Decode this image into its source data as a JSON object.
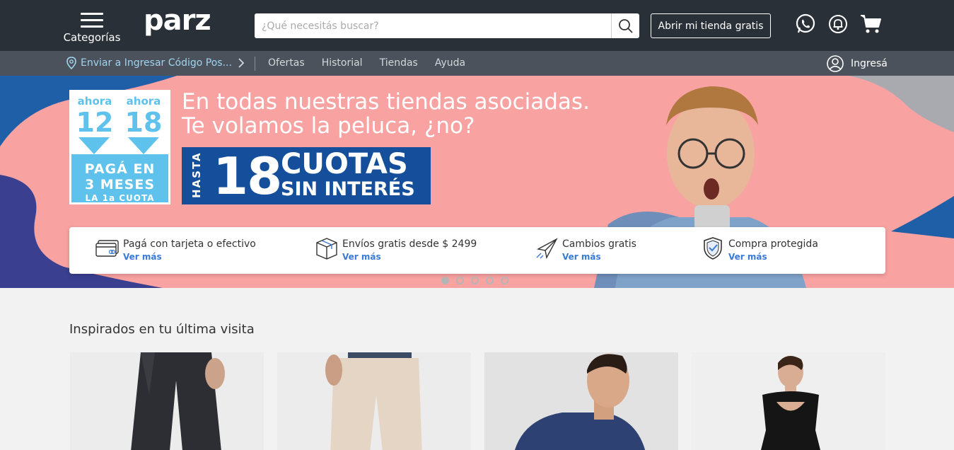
{
  "header": {
    "menu_label": "Categorías",
    "logo": "parz",
    "search_placeholder": "¿Qué necesitás buscar?",
    "open_store_label": "Abrir mi tienda gratis",
    "icons": [
      "whatsapp-icon",
      "bell-icon",
      "cart-icon"
    ]
  },
  "subnav": {
    "ship_prefix": "Enviar a",
    "ship_link": "Ingresar Código Pos...",
    "links": [
      "Ofertas",
      "Historial",
      "Tiendas",
      "Ayuda"
    ],
    "login_label": "Ingresá"
  },
  "hero": {
    "ahora_label": "ahora",
    "plan_a": "12",
    "plan_b": "18",
    "paga_line1": "PAGÁ EN",
    "paga_line2": "3 MESES",
    "paga_line3": "LA 1a CUOTA",
    "title_line1": "En todas nuestras tiendas asociadas.",
    "title_line2": "Te volamos la peluca, ¿no?",
    "hasta": "HASTA",
    "cuotas_number": "18",
    "cuotas_word": "CUOTAS",
    "sin_interes": "SIN INTERÉS"
  },
  "features": [
    {
      "icon": "credit-card-icon",
      "text": "Pagá con tarjeta o efectivo",
      "more": "Ver más"
    },
    {
      "icon": "package-icon",
      "text": "Envíos gratis desde $ 2499",
      "more": "Ver más"
    },
    {
      "icon": "paper-plane-icon",
      "text": "Cambios gratis",
      "more": "Ver más"
    },
    {
      "icon": "shield-check-icon",
      "text": "Compra protegida",
      "more": "Ver más"
    }
  ],
  "carousel": {
    "total": 5,
    "active": 1
  },
  "section": {
    "title": "Inspirados en tu última visita"
  },
  "colors": {
    "header": "#2a3038",
    "subnav": "#4b525b",
    "hero_bg": "#f8a2a1",
    "accent_blue": "#154f9c",
    "light_blue": "#5fc2ec",
    "link": "#3a7bd5"
  }
}
